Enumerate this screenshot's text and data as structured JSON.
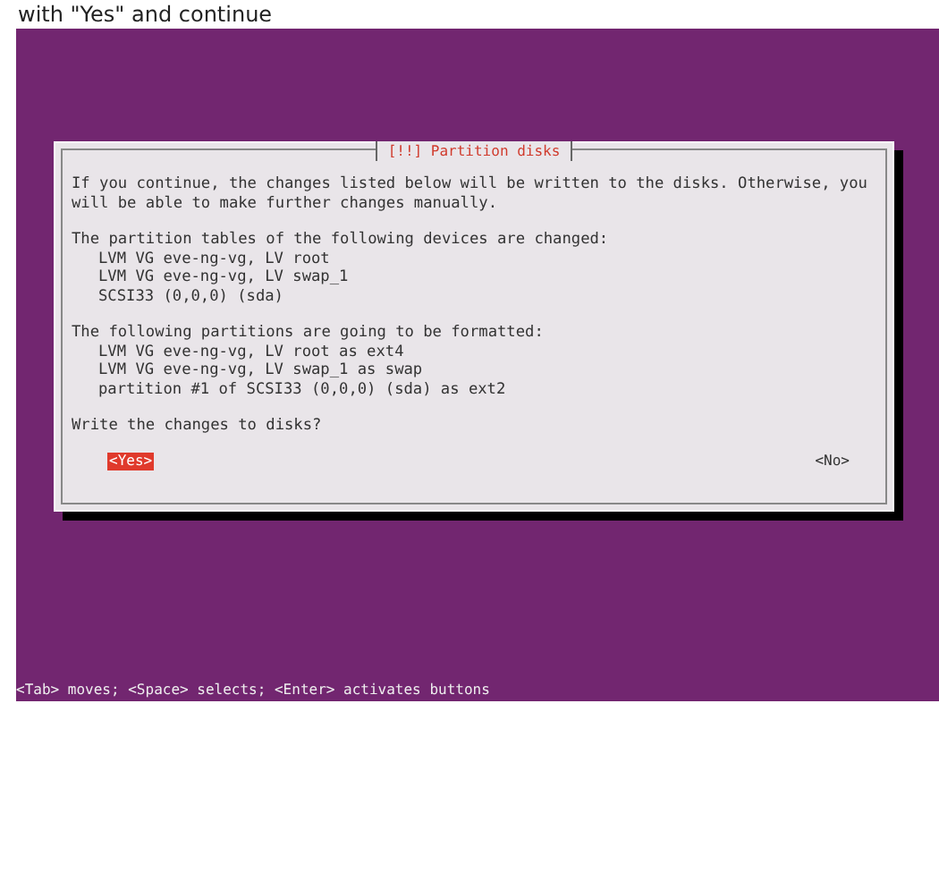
{
  "caption": "with \"Yes\" and continue",
  "dialog": {
    "title": "[!!] Partition disks",
    "intro": "If you continue, the changes listed below will be written to the disks. Otherwise, you will be able to make further changes manually.",
    "sections": [
      {
        "heading": "The partition tables of the following devices are changed:",
        "items": [
          "LVM VG eve-ng-vg, LV root",
          "LVM VG eve-ng-vg, LV swap_1",
          "SCSI33 (0,0,0) (sda)"
        ]
      },
      {
        "heading": "The following partitions are going to be formatted:",
        "items": [
          "LVM VG eve-ng-vg, LV root as ext4",
          "LVM VG eve-ng-vg, LV swap_1 as swap",
          "partition #1 of SCSI33 (0,0,0) (sda) as ext2"
        ]
      }
    ],
    "question": "Write the changes to disks?",
    "buttons": [
      {
        "label": "<Yes>",
        "selected": true
      },
      {
        "label": "<No>",
        "selected": false
      }
    ]
  },
  "status_bar": "<Tab> moves; <Space> selects; <Enter> activates buttons"
}
